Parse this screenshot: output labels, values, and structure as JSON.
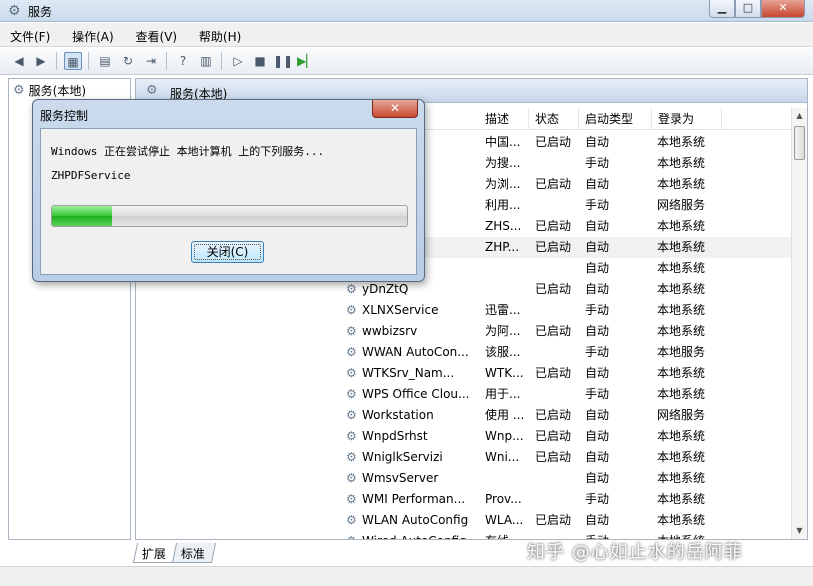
{
  "window": {
    "title": "服务",
    "min_label": "▁",
    "max_label": "□",
    "close_label": "✕"
  },
  "menu": [
    "文件(F)",
    "操作(A)",
    "查看(V)",
    "帮助(H)"
  ],
  "tree": {
    "root": "服务(本地)"
  },
  "pane": {
    "header": "服务(本地)",
    "columns": [
      "描述",
      "状态",
      "启动类型",
      "登录为"
    ]
  },
  "rows": [
    {
      "name": "",
      "desc": "中国...",
      "state": "已启动",
      "type": "自动",
      "logon": "本地系统"
    },
    {
      "name": "",
      "desc": "为搜...",
      "state": "",
      "type": "手动",
      "logon": "本地系统"
    },
    {
      "name": "",
      "desc": "为浏...",
      "state": "已启动",
      "type": "自动",
      "logon": "本地系统"
    },
    {
      "name": "",
      "desc": "利用...",
      "state": "",
      "type": "手动",
      "logon": "网络服务"
    },
    {
      "name": "",
      "desc": "ZHS...",
      "state": "已启动",
      "type": "自动",
      "logon": "本地系统"
    },
    {
      "name": "",
      "desc": "ZHP...",
      "state": "已启动",
      "type": "自动",
      "logon": "本地系统"
    },
    {
      "name": "",
      "desc": "",
      "state": "",
      "type": "自动",
      "logon": "本地系统"
    },
    {
      "name": "yDnZtQ",
      "desc": "",
      "state": "已启动",
      "type": "自动",
      "logon": "本地系统"
    },
    {
      "name": "XLNXService",
      "desc": "迅雷...",
      "state": "",
      "type": "手动",
      "logon": "本地系统"
    },
    {
      "name": "wwbizsrv",
      "desc": "为阿...",
      "state": "已启动",
      "type": "自动",
      "logon": "本地系统"
    },
    {
      "name": "WWAN AutoCon...",
      "desc": "该服...",
      "state": "",
      "type": "手动",
      "logon": "本地服务"
    },
    {
      "name": "WTKSrv_Nam...",
      "desc": "WTK...",
      "state": "已启动",
      "type": "自动",
      "logon": "本地系统"
    },
    {
      "name": "WPS Office Clou...",
      "desc": "用于...",
      "state": "",
      "type": "手动",
      "logon": "本地系统"
    },
    {
      "name": "Workstation",
      "desc": "使用 ...",
      "state": "已启动",
      "type": "自动",
      "logon": "网络服务"
    },
    {
      "name": "WnpdSrhst",
      "desc": "Wnp...",
      "state": "已启动",
      "type": "自动",
      "logon": "本地系统"
    },
    {
      "name": "WniglkServizi",
      "desc": "Wni...",
      "state": "已启动",
      "type": "自动",
      "logon": "本地系统"
    },
    {
      "name": "WmsvServer",
      "desc": "",
      "state": "",
      "type": "自动",
      "logon": "本地系统"
    },
    {
      "name": "WMI Performan...",
      "desc": "Prov...",
      "state": "",
      "type": "手动",
      "logon": "本地系统"
    },
    {
      "name": "WLAN AutoConfig",
      "desc": "WLA...",
      "state": "已启动",
      "type": "自动",
      "logon": "本地系统"
    },
    {
      "name": "Wired AutoConfig",
      "desc": "有线...",
      "state": "",
      "type": "手动",
      "logon": "本地系统"
    }
  ],
  "tabs": [
    "扩展",
    "标准"
  ],
  "dialog": {
    "title": "服务控制",
    "close_label": "✕",
    "message": "Windows 正在尝试停止 本地计算机 上的下列服务...",
    "service": "ZHPDFService",
    "progress": 0.17,
    "button": "关闭(C)"
  },
  "watermark": "知乎 @心如止水的岳阿菲",
  "colors": {
    "progress_green": "#37c735",
    "accent": "#3c7fb1"
  }
}
